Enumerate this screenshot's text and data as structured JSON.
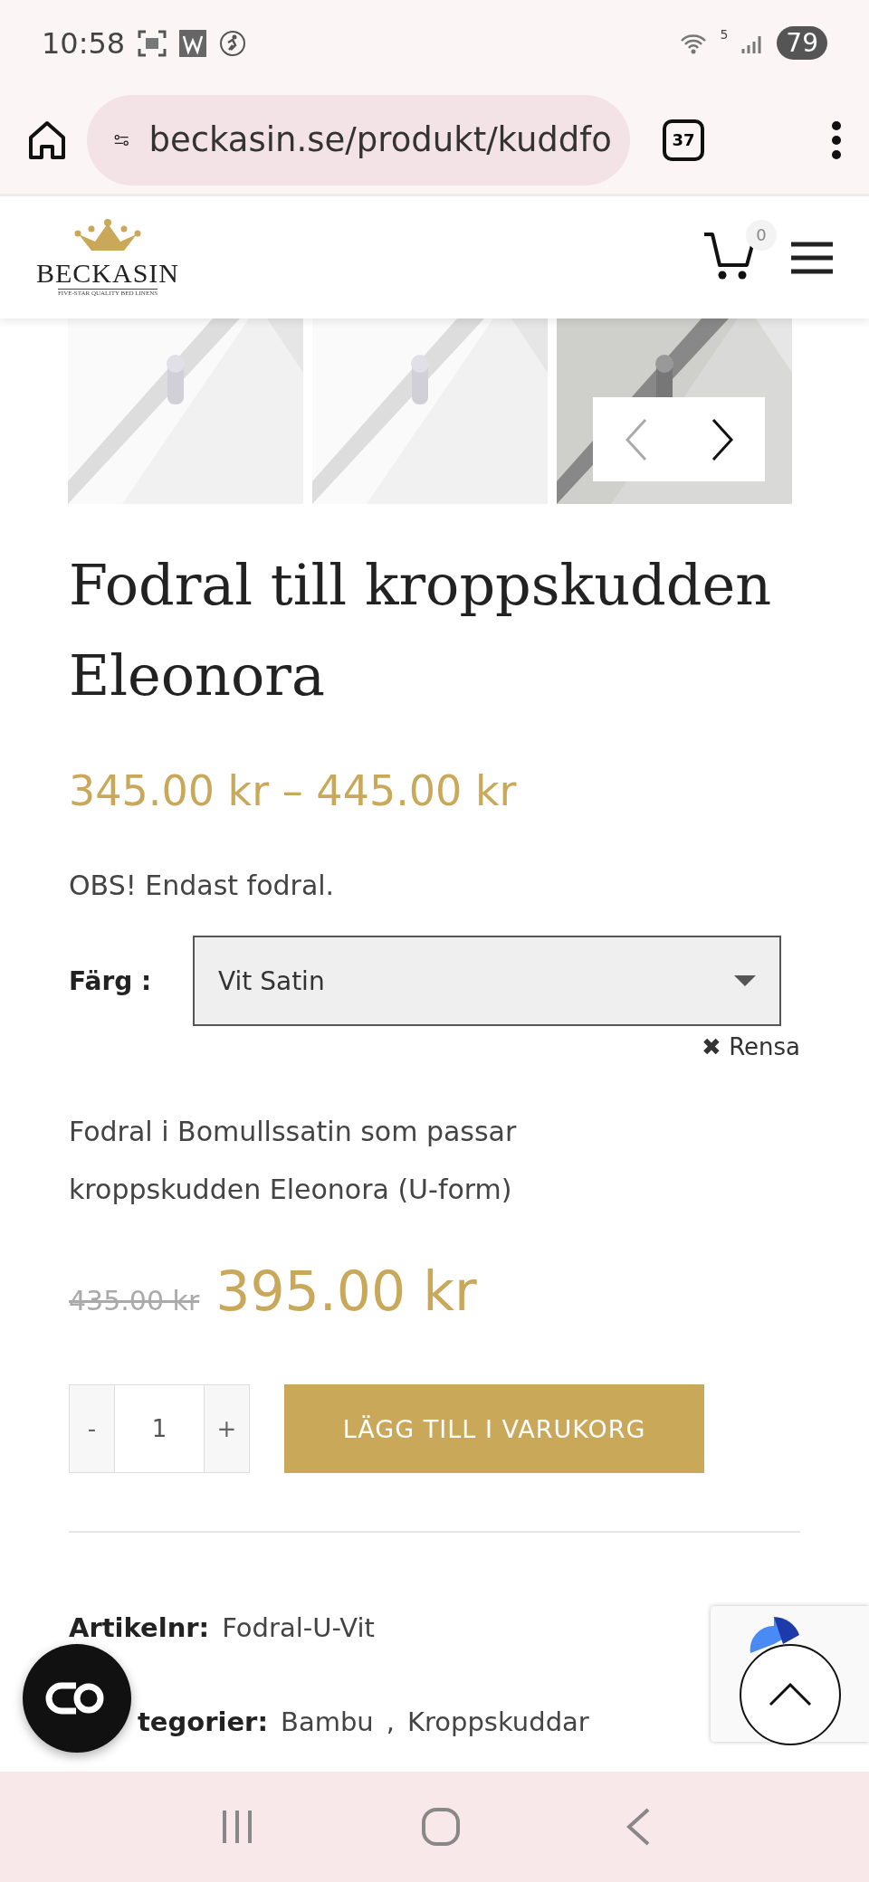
{
  "status_bar": {
    "time": "10:58",
    "wifi_badge": "5",
    "battery": "79"
  },
  "browser": {
    "url": "beckasin.se/produkt/kuddfo",
    "tab_count": "37"
  },
  "header": {
    "logo_text": "BECKASIN",
    "logo_tagline": "FIVE-STAR QUALITY BED LINENS",
    "cart_count": "0"
  },
  "gallery": {
    "prev_disabled": true
  },
  "product": {
    "title": "Fodral till kroppskudden Eleonora",
    "price_range": "345.00 kr – 445.00 kr",
    "notice": "OBS! Endast fodral.",
    "variant": {
      "label": "Färg",
      "separator": ":",
      "value": "Vit Satin"
    },
    "clear": {
      "icon": "✖",
      "label": "Rensa"
    },
    "description": "Fodral i Bomullssatin som passar kroppskudden Eleonora (U-form)",
    "old_price": "435.00 kr",
    "price": "395.00 kr",
    "quantity": {
      "minus": "-",
      "value": "1",
      "plus": "+"
    },
    "add_to_cart": "LÄGG TILL I VARUKORG",
    "meta": [
      {
        "label": "Artikelnr:",
        "values": [
          "Fodral-U-Vit"
        ]
      },
      {
        "label": "tegorier:",
        "kind": "covered",
        "values": [
          "Bambu",
          "Kroppskuddar"
        ],
        "separator": ","
      }
    ]
  }
}
